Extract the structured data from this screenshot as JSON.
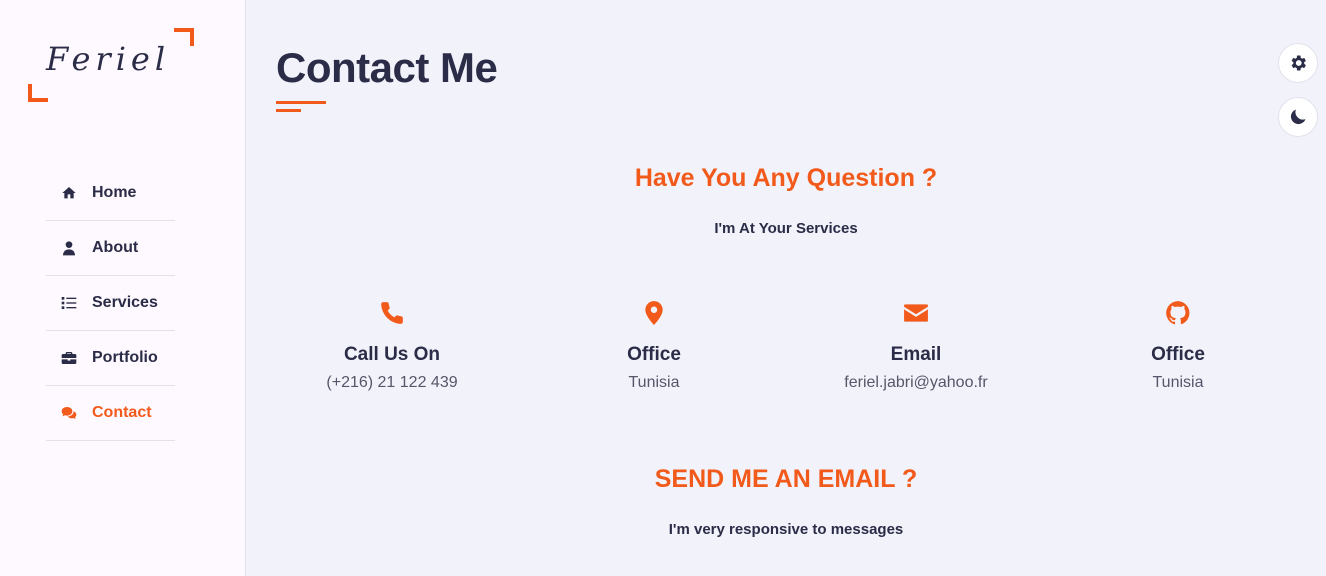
{
  "brand": {
    "name": "Feriel",
    "accent": "#f25a1c",
    "text": "#2b2c47"
  },
  "sidebar": {
    "items": [
      {
        "label": "Home",
        "icon": "home-icon",
        "active": false
      },
      {
        "label": "About",
        "icon": "user-icon",
        "active": false
      },
      {
        "label": "Services",
        "icon": "list-icon",
        "active": false
      },
      {
        "label": "Portfolio",
        "icon": "briefcase-icon",
        "active": false
      },
      {
        "label": "Contact",
        "icon": "comments-icon",
        "active": true
      }
    ]
  },
  "main": {
    "title": "Contact Me",
    "question_heading": "Have You Any Question ?",
    "question_sub": "I'm At Your Services",
    "contacts": [
      {
        "icon": "phone-icon",
        "label": "Call Us On",
        "value": "(+216) 21 122 439"
      },
      {
        "icon": "map-marker-icon",
        "label": "Office",
        "value": "Tunisia"
      },
      {
        "icon": "envelope-icon",
        "label": "Email",
        "value": "feriel.jabri@yahoo.fr"
      },
      {
        "icon": "github-icon",
        "label": "Office",
        "value": "Tunisia"
      }
    ],
    "email_heading": "SEND ME AN EMAIL ?",
    "email_sub": "I'm very responsive to messages"
  },
  "controls": {
    "settings_icon": "gear-icon",
    "theme_icon": "moon-icon"
  }
}
